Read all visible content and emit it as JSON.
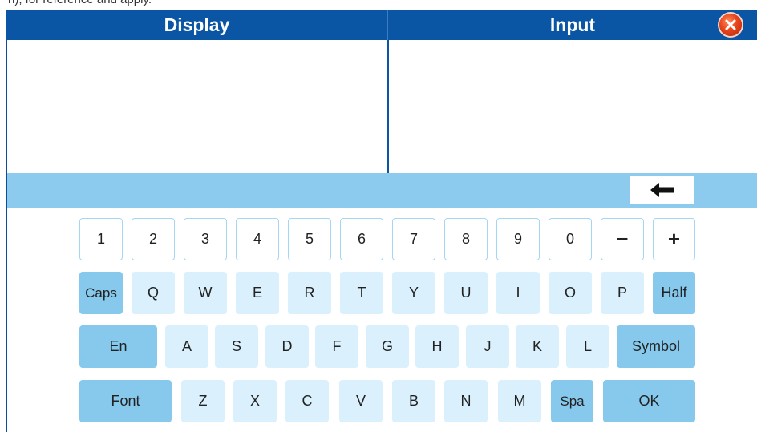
{
  "top_text": "n), for reference and apply.",
  "header": {
    "display_label": "Display",
    "input_label": "Input"
  },
  "panes": {
    "display_text": "",
    "input_text": ""
  },
  "keys": {
    "numbers": [
      "1",
      "2",
      "3",
      "4",
      "5",
      "6",
      "7",
      "8",
      "9",
      "0",
      "−",
      "+"
    ],
    "row1": {
      "caps": "Caps",
      "letters": [
        "Q",
        "W",
        "E",
        "R",
        "T",
        "Y",
        "U",
        "I",
        "O",
        "P"
      ],
      "half": "Half"
    },
    "row2": {
      "en": "En",
      "letters": [
        "A",
        "S",
        "D",
        "F",
        "G",
        "H",
        "J",
        "K",
        "L"
      ],
      "symbol": "Symbol"
    },
    "row3": {
      "font": "Font",
      "letters": [
        "Z",
        "X",
        "C",
        "V",
        "B",
        "N",
        "M"
      ],
      "spa": "Spa",
      "ok": "OK"
    }
  },
  "icons": {
    "close": "close-icon",
    "backspace": "backspace-arrow-icon"
  },
  "colors": {
    "header_bg": "#0b56a4",
    "control_bar": "#8ccbed",
    "letter_key": "#daf0fc",
    "function_key": "#86c9ec",
    "number_key_border": "#a5d7f2",
    "close_button": "#e8431a"
  }
}
